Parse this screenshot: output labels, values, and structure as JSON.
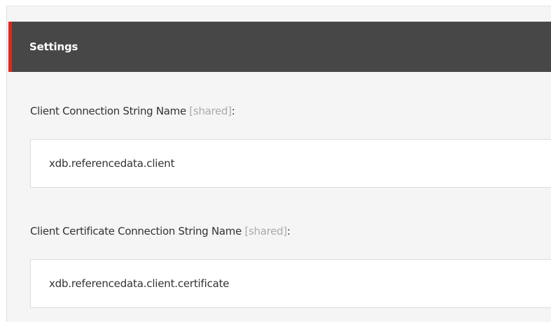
{
  "section": {
    "title": "Settings"
  },
  "fields": [
    {
      "label": "Client Connection String Name",
      "shared_tag": "[shared]",
      "colon": ":",
      "value": "xdb.referencedata.client"
    },
    {
      "label": "Client Certificate Connection String Name",
      "shared_tag": "[shared]",
      "colon": ":",
      "value": "xdb.referencedata.client.certificate"
    }
  ],
  "colors": {
    "header_background": "#474747",
    "accent": "#dc291e",
    "panel_background": "#f5f5f5",
    "shared_tag_text": "#aaaaaa"
  }
}
